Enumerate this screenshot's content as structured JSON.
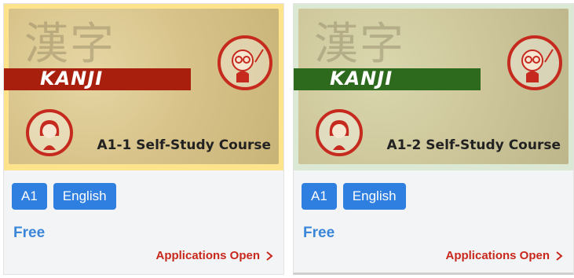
{
  "cards": [
    {
      "banner_kanji": "漢字",
      "banner_word": "KANJI",
      "course_title": "A1-1  Self-Study Course",
      "tags": [
        "A1",
        "English"
      ],
      "price": "Free",
      "status": "Applications Open",
      "stripe_color": "#a8200d"
    },
    {
      "banner_kanji": "漢字",
      "banner_word": "KANJI",
      "course_title": "A1-2 Self-Study Course",
      "tags": [
        "A1",
        "English"
      ],
      "price": "Free",
      "status": "Applications Open",
      "stripe_color": "#2e6a1d"
    }
  ],
  "colors": {
    "tag_bg": "#2f7fe0",
    "price_text": "#3a86d8",
    "status_text": "#c8281c",
    "seal": "#c62a1e"
  }
}
